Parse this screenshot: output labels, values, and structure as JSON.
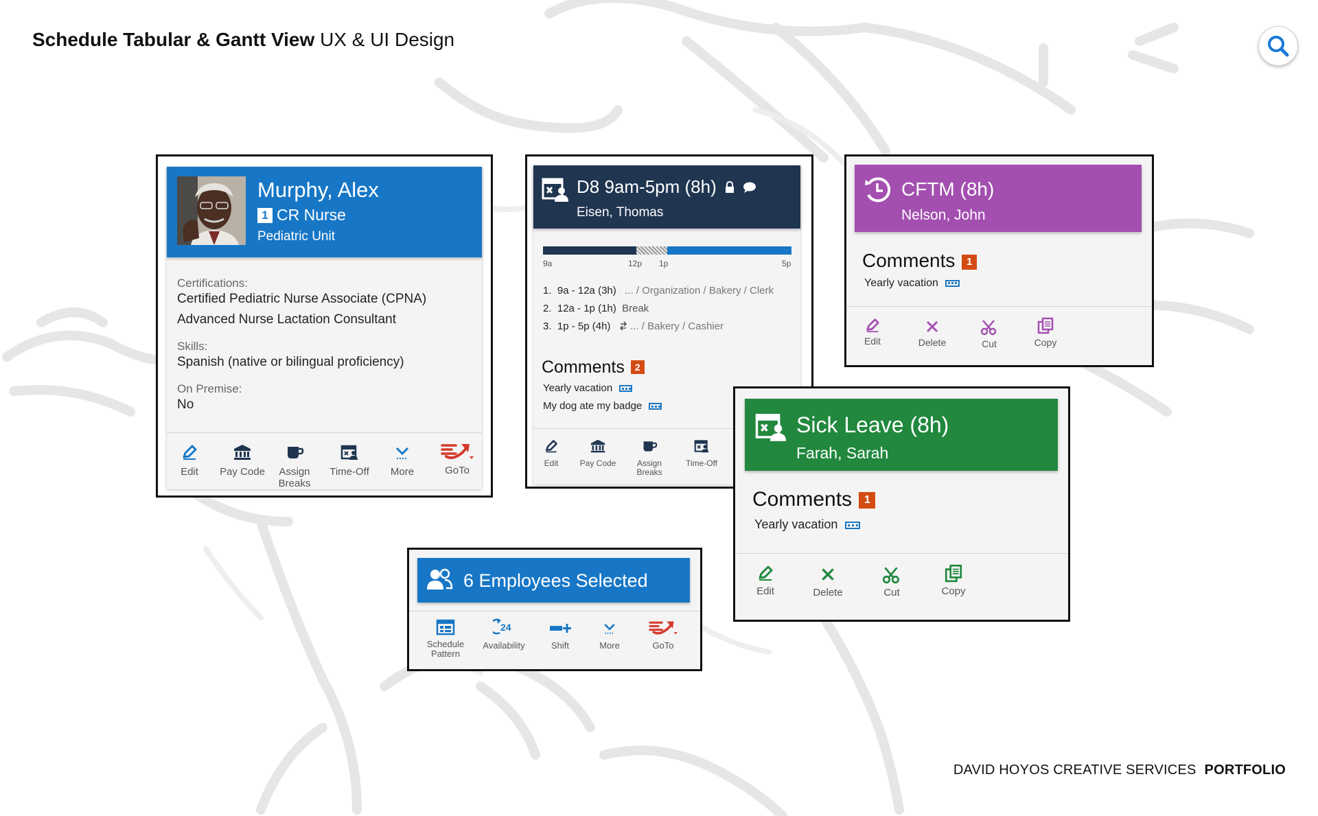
{
  "header": {
    "title_bold": "Schedule Tabular & Gantt View",
    "title_rest": "UX & UI Design"
  },
  "footer": {
    "company": "DAVID HOYOS CREATIVE SERVICES",
    "portfolio": "PORTFOLIO"
  },
  "colors": {
    "blue": "#1777c6",
    "navy": "#1f3550",
    "purple": "#a34fb0",
    "green": "#21883e",
    "orange_badge": "#d34b12",
    "red_goto": "#d53a2c"
  },
  "employee_card": {
    "name": "Murphy, Alex",
    "role_num": "1",
    "role": "CR Nurse",
    "unit": "Pediatric Unit",
    "cert_label": "Certifications:",
    "cert_1": "Certified Pediatric Nurse Associate (CPNA)",
    "cert_2": "Advanced Nurse Lactation Consultant",
    "skills_label": "Skills:",
    "skills": "Spanish (native or bilingual proficiency)",
    "premise_label": "On Premise:",
    "premise": "No",
    "actions": [
      {
        "label": "Edit",
        "icon": "pencil-icon"
      },
      {
        "label": "Pay Code",
        "icon": "bank-icon"
      },
      {
        "label": "Assign",
        "label2": "Breaks",
        "icon": "coffee-icon"
      },
      {
        "label": "Time-Off",
        "icon": "calendar-person-icon"
      },
      {
        "label": "More",
        "icon": "chevron-down-icon"
      },
      {
        "label": "GoTo",
        "icon": "goto-arrow-icon"
      }
    ]
  },
  "shift_card": {
    "title": "D8 9am-5pm (8h)",
    "employee": "Eisen, Thomas",
    "timeline_ticks": [
      "9a",
      "12p",
      "1p",
      "5p"
    ],
    "segments": [
      {
        "num": "1.",
        "time": "9a - 12a (3h)",
        "detail": "... / Organization / Bakery / Clerk"
      },
      {
        "num": "2.",
        "time": "12a - 1p (1h)",
        "detail": "Break"
      },
      {
        "num": "3.",
        "time": "1p - 5p (4h)",
        "detail": "... / Bakery / Cashier"
      }
    ],
    "comments_label": "Comments",
    "comments_count": "2",
    "comments": [
      "Yearly vacation",
      "My dog ate my badge"
    ],
    "actions": [
      {
        "label": "Edit",
        "icon": "pencil-icon"
      },
      {
        "label": "Pay Code",
        "icon": "bank-icon"
      },
      {
        "label": "Assign",
        "label2": "Breaks",
        "icon": "coffee-icon"
      },
      {
        "label": "Time-Off",
        "icon": "calendar-person-icon"
      }
    ]
  },
  "cftm_card": {
    "title": "CFTM (8h)",
    "employee": "Nelson, John",
    "comments_label": "Comments",
    "comments_count": "1",
    "comment": "Yearly vacation",
    "actions": [
      {
        "label": "Edit",
        "icon": "pencil-icon"
      },
      {
        "label": "Delete",
        "icon": "close-icon"
      },
      {
        "label": "Cut",
        "icon": "scissors-icon"
      },
      {
        "label": "Copy",
        "icon": "copy-icon"
      }
    ]
  },
  "sick_card": {
    "title": "Sick Leave (8h)",
    "employee": "Farah, Sarah",
    "comments_label": "Comments",
    "comments_count": "1",
    "comment": "Yearly vacation",
    "actions": [
      {
        "label": "Edit",
        "icon": "pencil-icon"
      },
      {
        "label": "Delete",
        "icon": "close-icon"
      },
      {
        "label": "Cut",
        "icon": "scissors-icon"
      },
      {
        "label": "Copy",
        "icon": "copy-icon"
      }
    ]
  },
  "group_card": {
    "title": "6 Employees Selected",
    "actions": [
      {
        "label": "Schedule",
        "label2": "Pattern",
        "icon": "schedule-grid-icon"
      },
      {
        "label": "Availability",
        "icon": "availability-24-icon"
      },
      {
        "label": "Shift",
        "icon": "shift-add-icon"
      },
      {
        "label": "More",
        "icon": "chevron-down-icon"
      },
      {
        "label": "GoTo",
        "icon": "goto-arrow-icon"
      }
    ]
  }
}
